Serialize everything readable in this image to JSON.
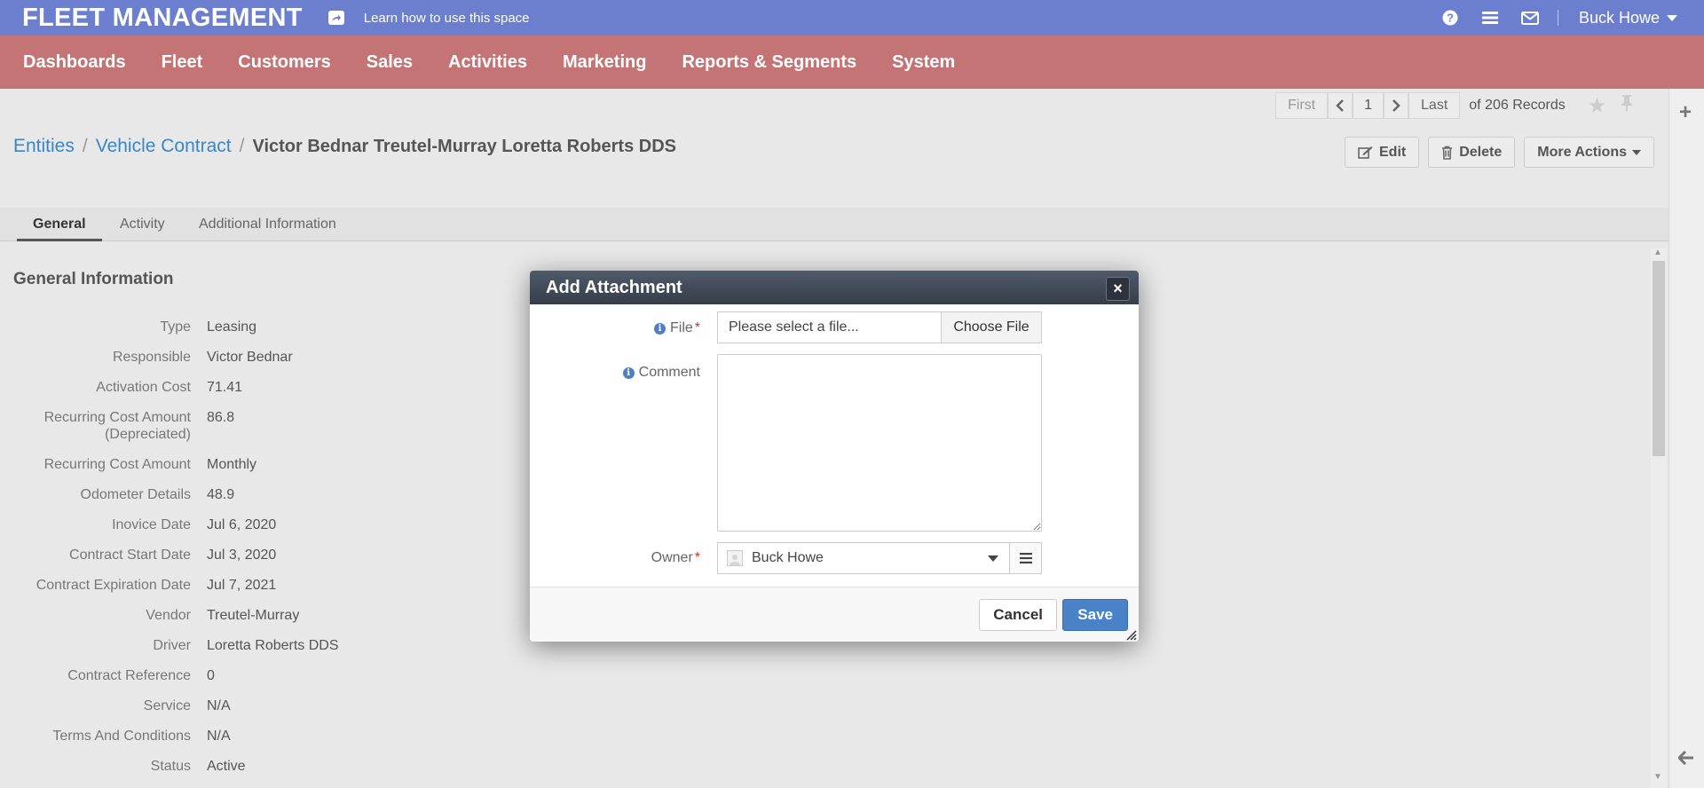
{
  "header": {
    "app_title": "FLEET MANAGEMENT",
    "help_link": "Learn how to use this space",
    "user_name": "Buck Howe"
  },
  "nav": {
    "items": [
      "Dashboards",
      "Fleet",
      "Customers",
      "Sales",
      "Activities",
      "Marketing",
      "Reports & Segments",
      "System"
    ]
  },
  "pager": {
    "first": "First",
    "page": "1",
    "last": "Last",
    "records": "of 206 Records"
  },
  "breadcrumb": {
    "entities": "Entities",
    "entity_type": "Vehicle Contract",
    "current": "Victor Bednar Treutel-Murray Loretta Roberts DDS"
  },
  "actions": {
    "edit": "Edit",
    "delete": "Delete",
    "more": "More Actions"
  },
  "tabs": [
    "General",
    "Activity",
    "Additional Information"
  ],
  "general": {
    "title": "General Information",
    "fields": [
      {
        "label": "Type",
        "value": "Leasing"
      },
      {
        "label": "Responsible",
        "value": "Victor Bednar"
      },
      {
        "label": "Activation Cost",
        "value": "71.41"
      },
      {
        "label": "Recurring Cost Amount",
        "label2": "(Depreciated)",
        "value": "86.8"
      },
      {
        "label": "Recurring Cost Amount",
        "value": "Monthly"
      },
      {
        "label": "Odometer Details",
        "value": "48.9"
      },
      {
        "label": "Inovice Date",
        "value": "Jul 6, 2020"
      },
      {
        "label": "Contract Start Date",
        "value": "Jul 3, 2020"
      },
      {
        "label": "Contract Expiration Date",
        "value": "Jul 7, 2021"
      },
      {
        "label": "Vendor",
        "value": "Treutel-Murray"
      },
      {
        "label": "Driver",
        "value": "Loretta Roberts DDS"
      },
      {
        "label": "Contract Reference",
        "value": "0"
      },
      {
        "label": "Service",
        "value": "N/A"
      },
      {
        "label": "Terms And Conditions",
        "value": "N/A"
      },
      {
        "label": "Status",
        "value": "Active"
      }
    ]
  },
  "modal": {
    "title": "Add Attachment",
    "close": "×",
    "file_label": "File",
    "required_mark": "*",
    "file_placeholder": "Please select a file...",
    "choose_file": "Choose File",
    "comment_label": "Comment",
    "comment_value": "",
    "owner_label": "Owner",
    "owner_value": "Buck Howe",
    "cancel": "Cancel",
    "save": "Save"
  },
  "colors": {
    "topbar": "#6b7fce",
    "mainnav": "#c47474",
    "link": "#3a86c8",
    "save": "#4a82c9"
  },
  "icons": [
    "share-icon",
    "help-icon",
    "menu-icon",
    "mail-icon",
    "chevron-left-icon",
    "chevron-right-icon",
    "star-icon",
    "pin-icon",
    "edit-icon",
    "trash-icon",
    "plus-icon",
    "arrow-left-icon",
    "info-icon",
    "close-icon",
    "list-icon",
    "user-avatar-icon"
  ]
}
